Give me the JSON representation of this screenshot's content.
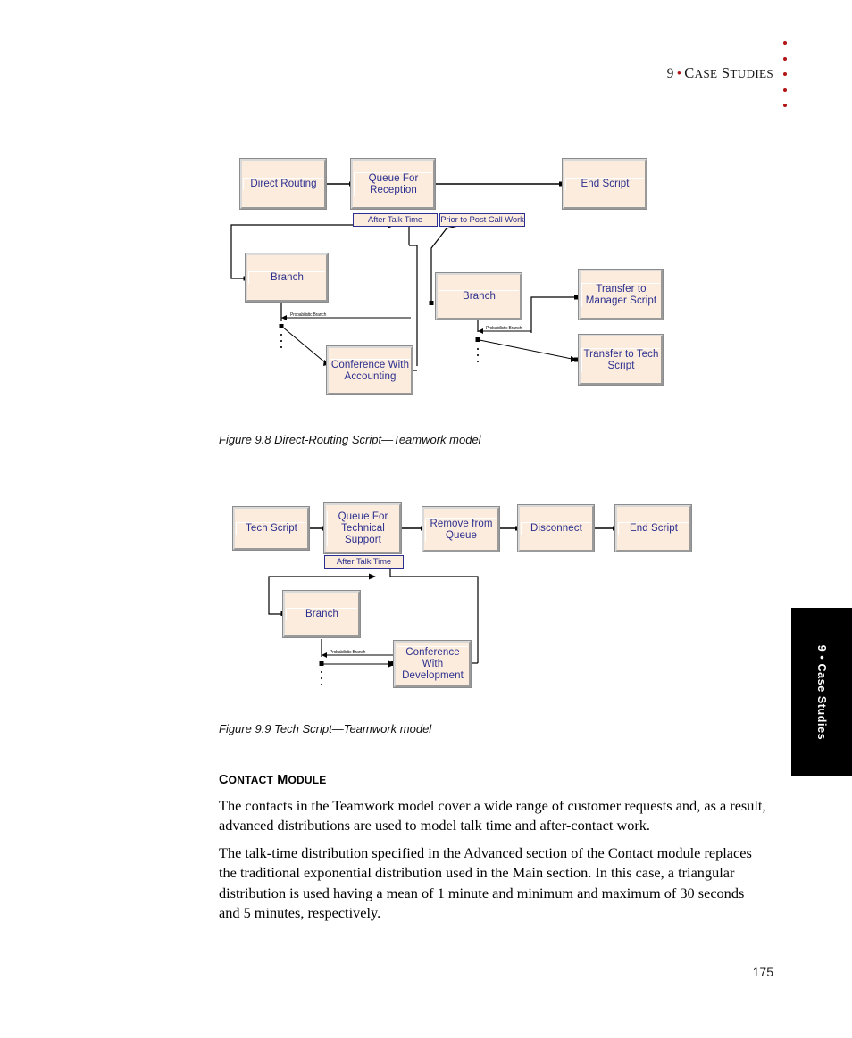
{
  "header": {
    "chapter_number": "9",
    "separator": "•",
    "chapter_title": "Case Studies",
    "margin_dot_count": 5,
    "dot_color": "#b11515"
  },
  "thumb_tab": {
    "label": "9 • Case Studies",
    "background": "#000000",
    "text_color": "#ffffff"
  },
  "figure_98": {
    "caption": "Figure 9.8 Direct-Routing Script—Teamwork model",
    "nodes": [
      {
        "id": "direct-routing",
        "label": "Direct Routing"
      },
      {
        "id": "queue-for-reception",
        "label": "Queue For\nReception"
      },
      {
        "id": "end-script",
        "label": "End Script"
      },
      {
        "id": "branch-left",
        "label": "Branch"
      },
      {
        "id": "branch-right",
        "label": "Branch"
      },
      {
        "id": "conference-with-accounting",
        "label": "Conference With\nAccounting"
      },
      {
        "id": "transfer-to-manager-script",
        "label": "Transfer to\nManager Script"
      },
      {
        "id": "transfer-to-tech-script",
        "label": "Transfer to Tech\nScript"
      }
    ],
    "label_boxes": [
      {
        "id": "after-talk-time",
        "label": "After Talk Time"
      },
      {
        "id": "prior-to-post-call-work",
        "label": "Prior to Post Call Work"
      }
    ],
    "edge_labels": [
      {
        "id": "probabilistic-branch-left",
        "label": "Probabilistic Branch"
      },
      {
        "id": "probabilistic-branch-right",
        "label": "Probabilistic Branch"
      }
    ]
  },
  "figure_99": {
    "caption": "Figure 9.9 Tech Script—Teamwork model",
    "nodes": [
      {
        "id": "tech-script",
        "label": "Tech Script"
      },
      {
        "id": "queue-for-technical-support",
        "label": "Queue For\nTechnical\nSupport"
      },
      {
        "id": "remove-from-queue",
        "label": "Remove from\nQueue"
      },
      {
        "id": "disconnect",
        "label": "Disconnect"
      },
      {
        "id": "end-script",
        "label": "End Script"
      },
      {
        "id": "branch",
        "label": "Branch"
      },
      {
        "id": "conference-with-development",
        "label": "Conference With\nDevelopment"
      }
    ],
    "label_boxes": [
      {
        "id": "after-talk-time",
        "label": "After Talk Time"
      }
    ],
    "edge_labels": [
      {
        "id": "probabilistic-branch",
        "label": "Probabilistic Branch"
      }
    ]
  },
  "section": {
    "heading": "Contact module",
    "paragraphs": [
      "The contacts in the Teamwork model cover a wide range of customer requests and, as a result, advanced distributions are used to model talk time and after-contact work.",
      "The talk-time distribution specified in the Advanced section of the Contact module replaces the traditional exponential distribution used in the Main section. In this case, a triangular distribution is used having a mean of 1 minute and minimum and maximum of 30 seconds and 5 minutes, respectively."
    ]
  },
  "page_number": "175",
  "colors": {
    "node_fill": "#fcecdd",
    "node_text": "#2b2f8f",
    "node_border_light": "#d9d9d9",
    "node_border_dark": "#9a9a9a",
    "wire": "#000000"
  }
}
